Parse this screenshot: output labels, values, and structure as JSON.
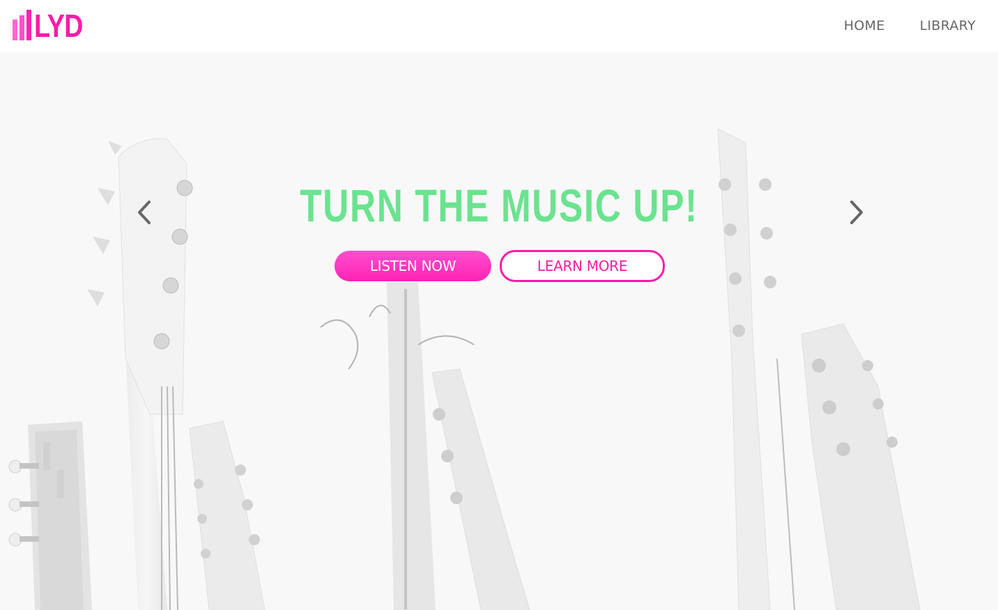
{
  "header": {
    "logo_text": "LYD",
    "nav": [
      {
        "label": "HOME"
      },
      {
        "label": "LIBRARY"
      }
    ]
  },
  "hero": {
    "headline": "TURN THE MUSIC UP!",
    "primary_button": "LISTEN NOW",
    "secondary_button": "LEARN MORE",
    "prev_icon": "chevron-left-icon",
    "next_icon": "chevron-right-icon",
    "background_image": "guitar headstocks photo (faded grayscale)"
  },
  "colors": {
    "brand_pink": "#ff1aaa",
    "headline_green": "#6be38f",
    "nav_gray": "#666666"
  }
}
